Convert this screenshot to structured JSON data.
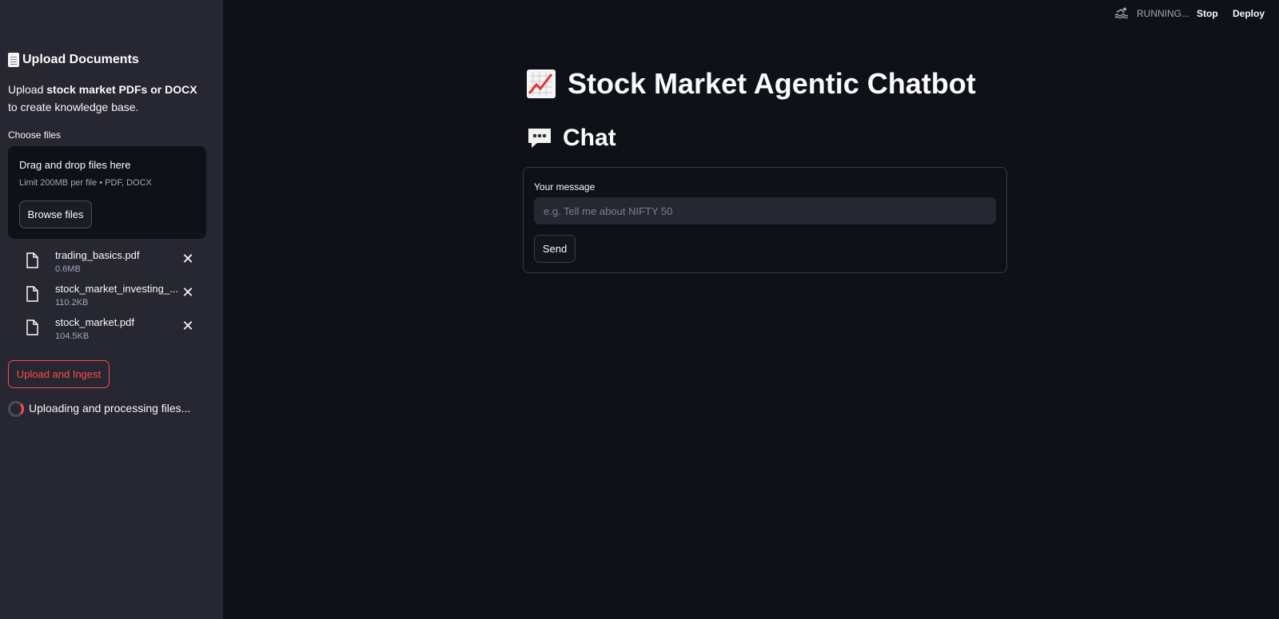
{
  "sidebar": {
    "title": "Upload Documents",
    "desc_prefix": "Upload ",
    "desc_bold": "stock market PDFs or DOCX",
    "desc_suffix": " to create knowledge base.",
    "choose_label": "Choose files",
    "dropzone": {
      "title": "Drag and drop files here",
      "limit": "Limit 200MB per file • PDF, DOCX",
      "browse_label": "Browse files"
    },
    "files": [
      {
        "name": "trading_basics.pdf",
        "size": "0.6MB"
      },
      {
        "name": "stock_market_investing_...",
        "size": "110.2KB"
      },
      {
        "name": "stock_market.pdf",
        "size": "104.5KB"
      }
    ],
    "upload_button": "Upload and Ingest",
    "status": "Uploading and processing files..."
  },
  "topbar": {
    "running": "RUNNING...",
    "stop": "Stop",
    "deploy": "Deploy"
  },
  "main": {
    "title": "Stock Market Agentic Chatbot",
    "chat_heading": "Chat",
    "form": {
      "label": "Your message",
      "placeholder": "e.g. Tell me about NIFTY 50",
      "value": "",
      "send_label": "Send"
    }
  },
  "colors": {
    "background": "#0e1117",
    "sidebar": "#262730",
    "accent": "#ff4b4b",
    "text": "#fafafa"
  },
  "icons": {
    "title_icon": "document-icon",
    "main_title_icon": "chart-increasing-icon",
    "chat_icon": "speech-bubble-icon",
    "file_icon": "file-icon",
    "remove_icon": "close-icon",
    "running_icon": "swimmer-icon"
  }
}
